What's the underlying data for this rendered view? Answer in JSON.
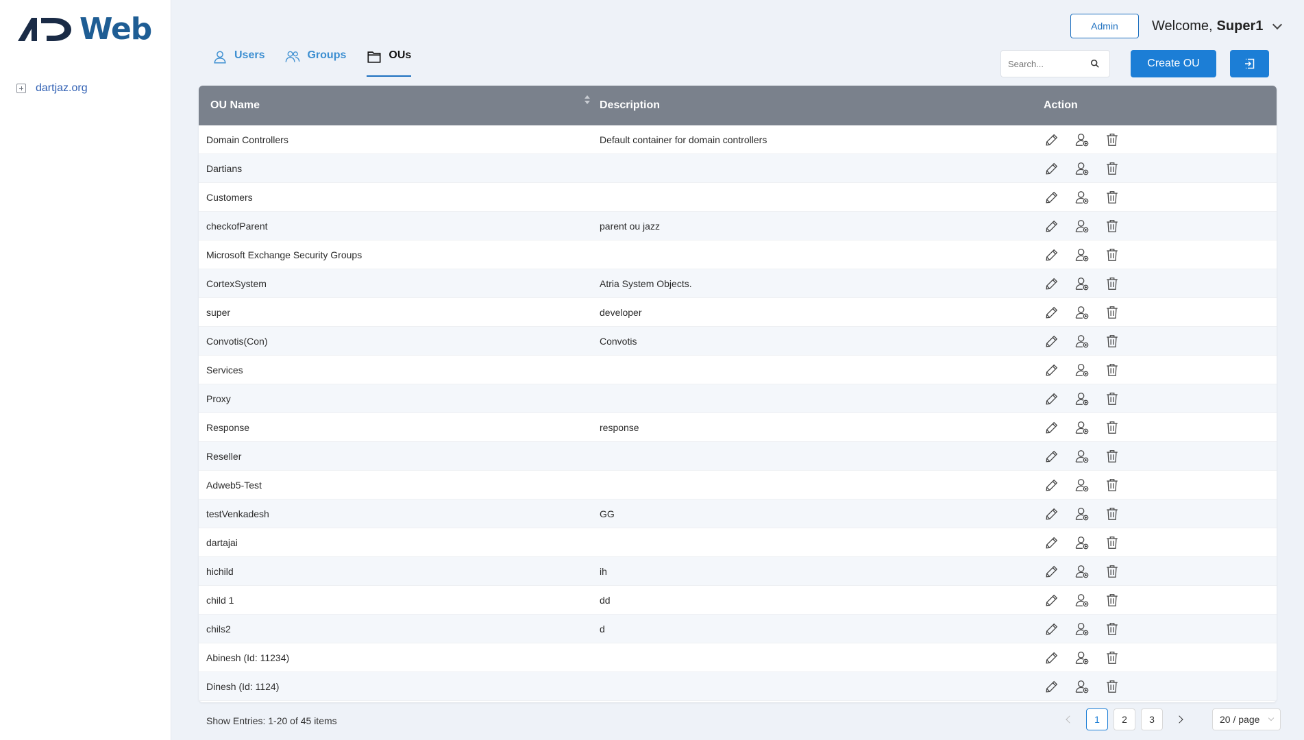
{
  "brand": {
    "logo_text": "Web",
    "colors": {
      "primary": "#1c7ed6",
      "logo": "#1e5d94",
      "header": "#7a818c"
    }
  },
  "sidebar": {
    "tree": [
      {
        "label": "dartjaz.org",
        "icon": "expand-square-icon"
      }
    ]
  },
  "header": {
    "admin_label": "Admin",
    "welcome_text": "Welcome,",
    "username": "Super1"
  },
  "tabs": [
    {
      "label": "Users",
      "icon": "user-icon",
      "active": false
    },
    {
      "label": "Groups",
      "icon": "users-icon",
      "active": false
    },
    {
      "label": "OUs",
      "icon": "folder-icon",
      "active": true
    }
  ],
  "search": {
    "placeholder": "Search..."
  },
  "actions": {
    "create_label": "Create OU",
    "export_icon": "import-icon"
  },
  "table": {
    "columns": [
      "OU Name",
      "Description",
      "Action"
    ],
    "rows": [
      {
        "name": "Domain Controllers",
        "description": "Default container for domain controllers"
      },
      {
        "name": "Dartians",
        "description": ""
      },
      {
        "name": "Customers",
        "description": ""
      },
      {
        "name": "checkofParent",
        "description": "parent ou jazz"
      },
      {
        "name": "Microsoft Exchange Security Groups",
        "description": ""
      },
      {
        "name": "CortexSystem",
        "description": "Atria System Objects."
      },
      {
        "name": "super",
        "description": "developer"
      },
      {
        "name": "Convotis(Con)",
        "description": "Convotis"
      },
      {
        "name": "Services",
        "description": ""
      },
      {
        "name": "Proxy",
        "description": ""
      },
      {
        "name": "Response",
        "description": "response"
      },
      {
        "name": "Reseller",
        "description": ""
      },
      {
        "name": "Adweb5-Test",
        "description": ""
      },
      {
        "name": "testVenkadesh",
        "description": "GG"
      },
      {
        "name": "dartajai",
        "description": ""
      },
      {
        "name": "hichild",
        "description": "ih"
      },
      {
        "name": "child 1",
        "description": "dd"
      },
      {
        "name": "chils2",
        "description": "d"
      },
      {
        "name": "Abinesh (Id: 11234)",
        "description": ""
      },
      {
        "name": "Dinesh (Id: 1124)",
        "description": ""
      }
    ],
    "row_actions": [
      "edit-icon",
      "add-user-icon",
      "delete-icon"
    ]
  },
  "footer": {
    "entries_text": "Show Entries: 1-20 of 45 items",
    "pages": [
      "1",
      "2",
      "3"
    ],
    "current_page": "1",
    "page_size": "20 / page"
  }
}
